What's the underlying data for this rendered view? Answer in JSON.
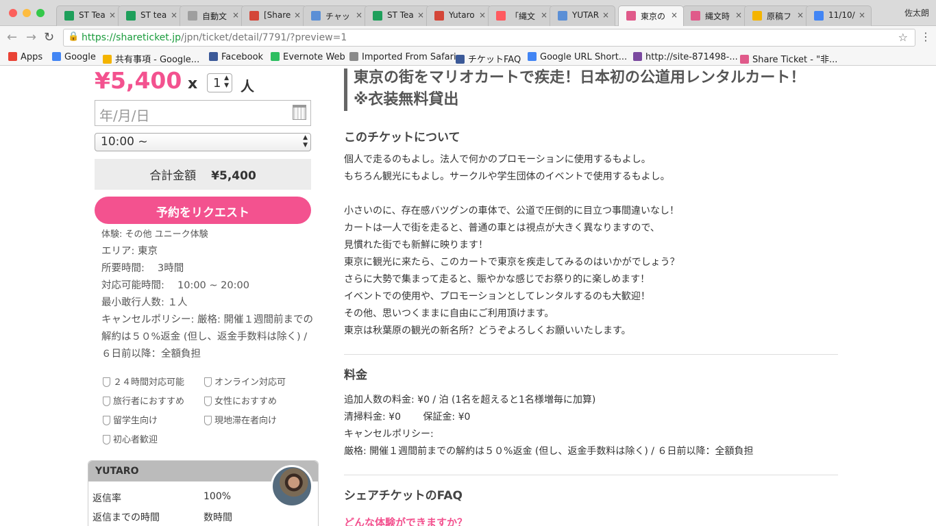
{
  "browser": {
    "tabs": [
      {
        "label": "ST Tea",
        "fav": "#1e9f5b"
      },
      {
        "label": "ST tea",
        "fav": "#1e9f5b"
      },
      {
        "label": "自動文",
        "fav": "#9e9e9e"
      },
      {
        "label": "[Share",
        "fav": "#d44638"
      },
      {
        "label": "チャッ",
        "fav": "#5b8fd6"
      },
      {
        "label": "ST Tea",
        "fav": "#1e9f5b"
      },
      {
        "label": "Yutaro",
        "fav": "#d44638"
      },
      {
        "label": "「縄文",
        "fav": "#ff5a5f"
      },
      {
        "label": "YUTAR",
        "fav": "#5b8fd6"
      },
      {
        "label": "東京の",
        "fav": "#e05a8a"
      },
      {
        "label": "縄文時",
        "fav": "#e05a8a"
      },
      {
        "label": "原稿フ",
        "fav": "#f4b400"
      },
      {
        "label": "11/10/",
        "fav": "#4285f4"
      }
    ],
    "profile_name": "佐太朗",
    "url_host": "https://shareticket.jp",
    "url_path": "/jpn/ticket/detail/7791/?preview=1",
    "bookmarks": [
      {
        "label": "Apps",
        "color": "#e94235"
      },
      {
        "label": "Google",
        "color": "#4285f4"
      },
      {
        "label": "共有事項 - Google...",
        "color": "#f4b400"
      },
      {
        "label": "Facebook",
        "color": "#3b5998"
      },
      {
        "label": "Evernote Web",
        "color": "#2dbe60"
      },
      {
        "label": "Imported From Safari",
        "color": "#8a8a8a"
      },
      {
        "label": "チケットFAQ",
        "color": "#3b5998"
      },
      {
        "label": "Google URL Short...",
        "color": "#4285f4"
      },
      {
        "label": "http://site-871498-...",
        "color": "#7b4aa0"
      },
      {
        "label": "Share Ticket - \"非...",
        "color": "#e05a8a"
      }
    ]
  },
  "booking": {
    "price": "¥5,400",
    "times": "x",
    "qty": "1",
    "qty_unit": "人",
    "date_placeholder": "年/月/日",
    "time_value": "10:00 ~",
    "total_label": "合計金額",
    "total_value": "¥5,400",
    "request_button": "予約をリクエスト"
  },
  "details": [
    "体験: その他 ユニーク体験",
    "エリア: 東京",
    "所要時間: 　3時間",
    "対応可能時間: 　10:00 ~ 20:00",
    "最小敢行人数: １人",
    "キャンセルポリシー: 厳格: 開催１週間前までの",
    "解約は５０%返金 (但し、返金手数料は除く) /",
    "６日前以降：全額負担"
  ],
  "features": [
    "２４時間対応可能",
    "オンライン対応可",
    "旅行者におすすめ",
    "女性におすすめ",
    "留学生向け",
    "現地滞在者向け",
    "初心者歓迎"
  ],
  "host": {
    "name": "YUTARO",
    "rows": [
      {
        "label": "返信率",
        "value": "100%"
      },
      {
        "label": "返信までの時間",
        "value": "数時間"
      }
    ]
  },
  "ticket": {
    "title_line1": "東京の街をマリオカートで疾走！日本初の公道用レンタルカート！",
    "title_line2": "※衣装無料貸出",
    "about_heading": "このチケットについて",
    "about_lines": [
      "個人で走るのもよし。法人で何かのプロモーションに使用するもよし。",
      "もちろん観光にもよし。サークルや学生団体のイベントで使用するもよし。",
      "",
      "小さいのに、存在感バツグンの車体で、公道で圧倒的に目立つ事間違いなし！",
      "カートは一人で街を走ると、普通の車とは視点が大きく異なりますので、",
      "見慣れた街でも新鮮に映ります！",
      "東京に観光に来たら、このカートで東京を疾走してみるのはいかがでしょう？",
      "さらに大勢で集まって走ると、賑やかな感じでお祭り的に楽しめます！",
      "イベントでの使用や、プロモーションとしてレンタルするのも大歓迎！",
      "その他、思いつくままに自由にご利用頂けます。",
      "東京は秋葉原の観光の新名所？どうぞよろしくお願いいたします。"
    ],
    "fee_heading": "料金",
    "fee_lines": [
      "追加人数の料金:  ¥0 / 泊 (1名を超えると1名様増毎に加算)",
      "清掃料金:  ¥0 　　保証金:  ¥0",
      "キャンセルポリシー:",
      "厳格: 開催１週間前までの解約は５０%返金 (但し、返金手数料は除く) / ６日前以降：全額負担"
    ],
    "faq_heading": "シェアチケットのFAQ",
    "faq_question": "どんな体験ができますか？"
  }
}
